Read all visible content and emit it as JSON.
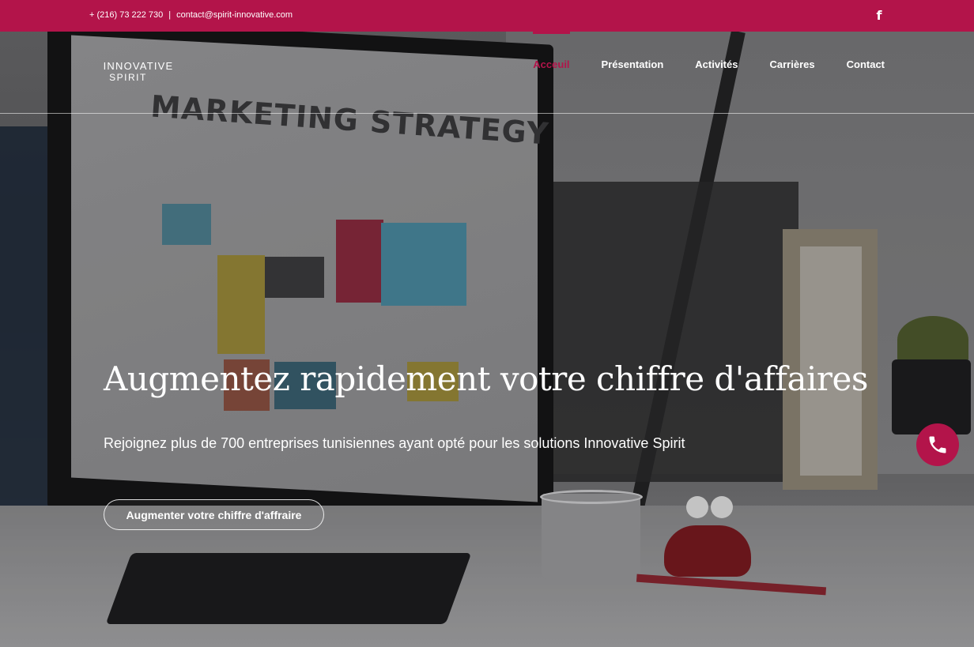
{
  "topbar": {
    "phone": "+ (216) 73 222 730",
    "separator": "|",
    "email": "contact@spirit-innovative.com",
    "social_icon": "facebook-icon",
    "social_glyph": "f",
    "background_color": "#b3144a"
  },
  "header": {
    "logo": {
      "line1": "INNOVATIVE",
      "line2": "SPIRIT"
    },
    "nav": [
      {
        "label": "Acceuil",
        "active": true
      },
      {
        "label": "Présentation",
        "active": false
      },
      {
        "label": "Activités",
        "active": false
      },
      {
        "label": "Carrières",
        "active": false
      },
      {
        "label": "Contact",
        "active": false
      }
    ],
    "accent_color": "#b3144a"
  },
  "hero": {
    "title": "Augmentez rapidement votre chiffre d'affaires",
    "subtitle": "Rejoignez plus de 700 entreprises tunisiennes ayant opté pour les solutions Innovative Spirit",
    "cta_label": "Augmenter votre chiffre d'affraire",
    "background_photo_text": "MARKETING STRATEGY"
  },
  "floating": {
    "call_icon": "phone-icon"
  }
}
